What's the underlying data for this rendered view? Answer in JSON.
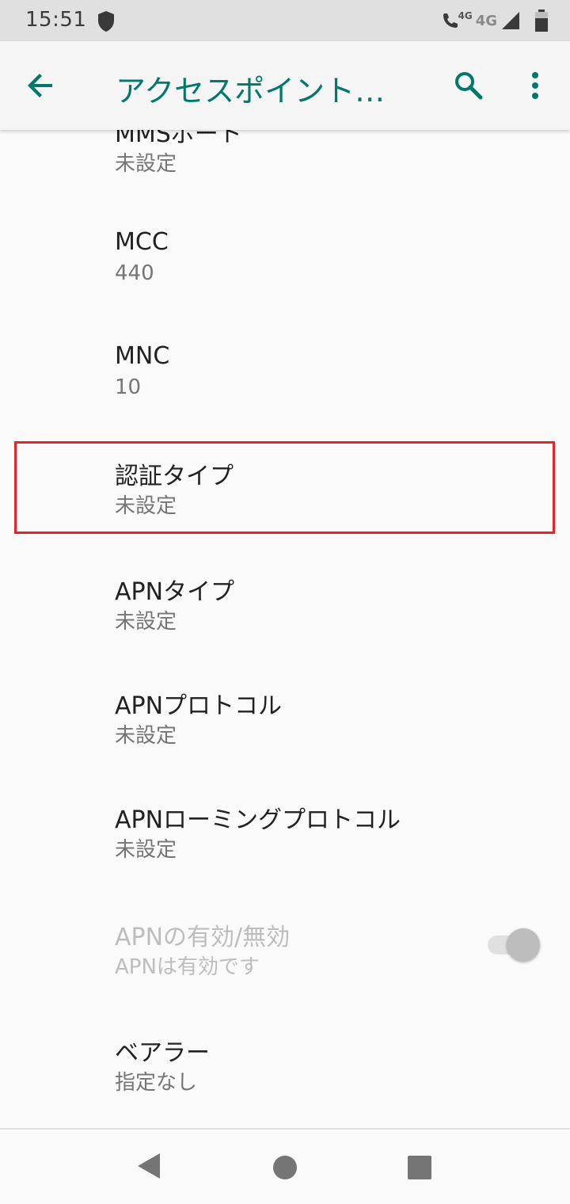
{
  "status_bar": {
    "time": "15:51",
    "network_small": "4G",
    "network": "4G",
    "icons": [
      "shield-icon",
      "wifi-calling-icon",
      "signal-icon",
      "battery-icon"
    ]
  },
  "app_bar": {
    "title": "アクセスポイント…",
    "back_icon": "arrow-back-icon",
    "search_icon": "search-icon",
    "more_icon": "more-vert-icon",
    "accent_color": "#00796b"
  },
  "preferences": [
    {
      "title": "MMSポート",
      "summary": "未設定"
    },
    {
      "title": "MCC",
      "summary": "440"
    },
    {
      "title": "MNC",
      "summary": "10"
    },
    {
      "title": "認証タイプ",
      "summary": "未設定",
      "highlighted": true
    },
    {
      "title": "APNタイプ",
      "summary": "未設定"
    },
    {
      "title": "APNプロトコル",
      "summary": "未設定"
    },
    {
      "title": "APNローミングプロトコル",
      "summary": "未設定"
    },
    {
      "title": "APNの有効/無効",
      "summary": "APNは有効です",
      "enabled": false,
      "toggle_on": true
    },
    {
      "title": "ベアラー",
      "summary": "指定なし"
    }
  ],
  "highlight_color": "#e2252d",
  "nav_bar": {
    "icons": [
      "nav-back-icon",
      "nav-home-icon",
      "nav-recents-icon"
    ]
  }
}
